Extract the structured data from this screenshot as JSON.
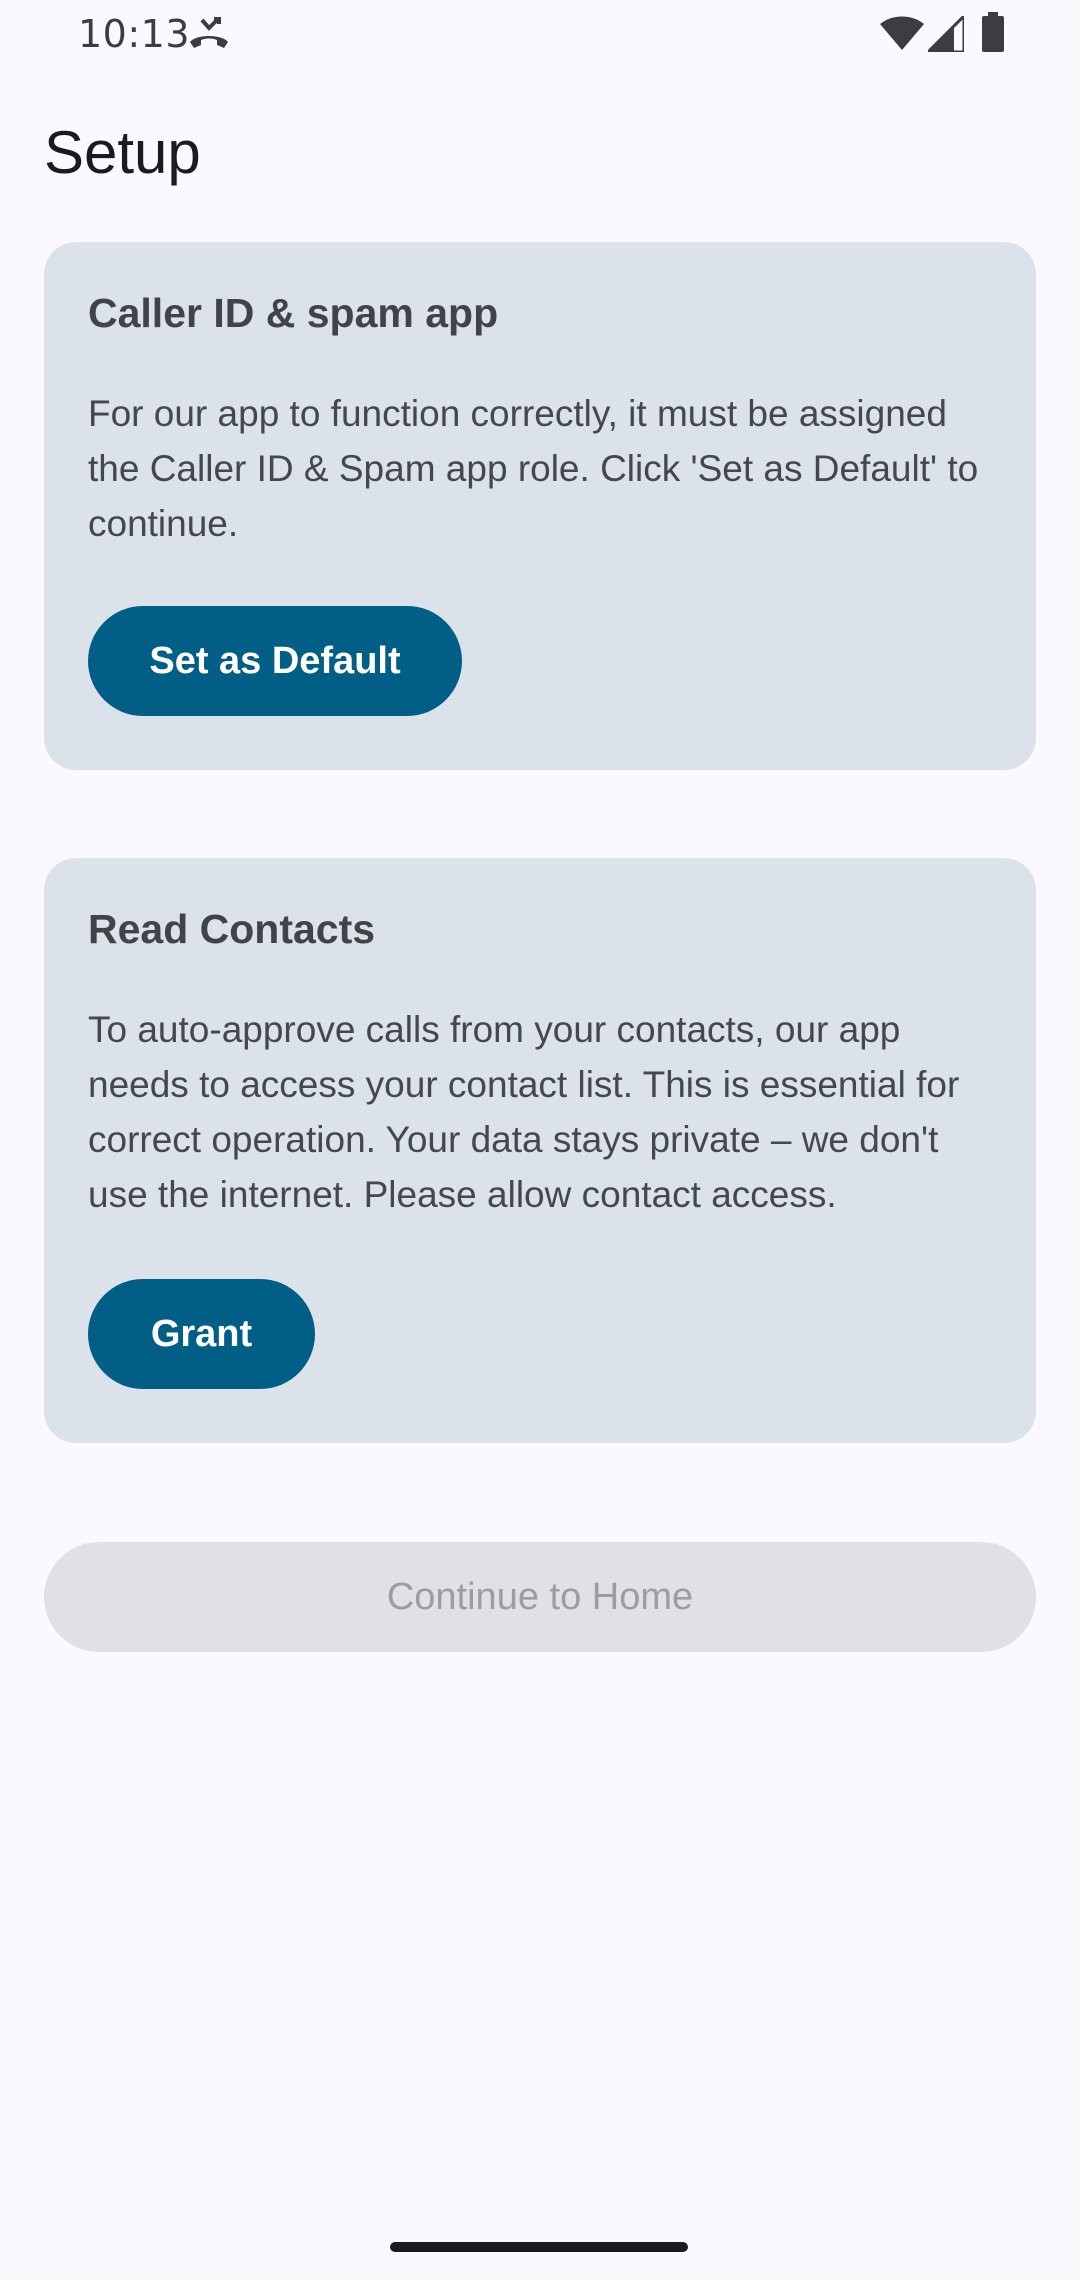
{
  "status_bar": {
    "time": "10:13",
    "icons": [
      "missed-call-icon",
      "wifi-icon",
      "signal-icon",
      "battery-icon"
    ]
  },
  "header": {
    "title": "Setup"
  },
  "cards": {
    "role": {
      "title": "Caller ID & spam app",
      "description": "For our app to function correctly, it must be assigned the Caller ID & Spam app role. Click 'Set as Default' to continue.",
      "button_label": "Set as Default"
    },
    "contacts": {
      "title": "Read Contacts",
      "description": "To auto-approve calls from your contacts, our app needs to access your contact list. This is essential for correct operation. Your data stays private – we don't use the internet. Please allow contact access.",
      "button_label": "Grant"
    }
  },
  "footer": {
    "continue_label": "Continue to Home",
    "continue_enabled": false
  },
  "colors": {
    "background": "#faf9fd",
    "card_background": "#dce2e9",
    "primary_button": "#005e87",
    "disabled_button": "#e1e1e5",
    "disabled_text": "#9c9da1"
  }
}
